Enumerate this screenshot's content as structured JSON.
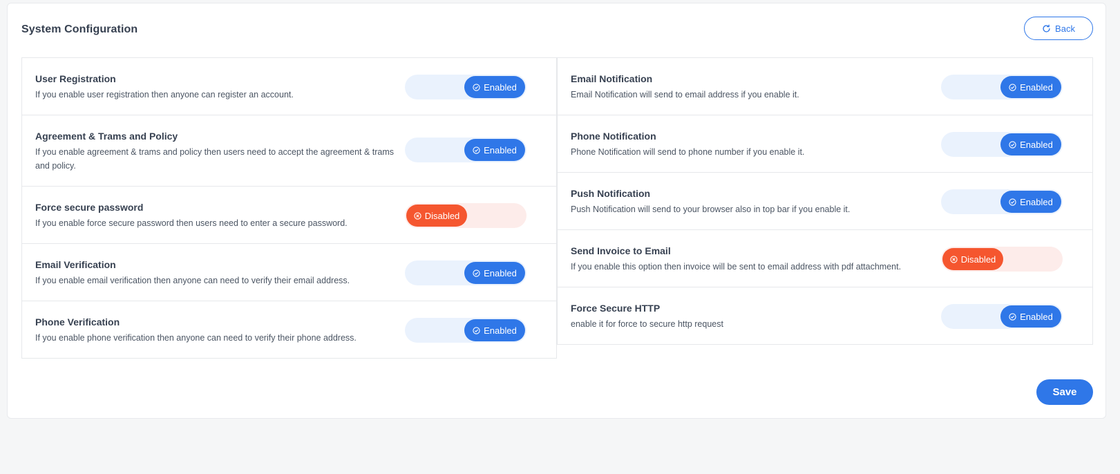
{
  "header": {
    "title": "System Configuration",
    "back_label": "Back"
  },
  "colors": {
    "accent": "#2f77e8",
    "enabled_track": "#eaf2fd",
    "disabled": "#f5562f",
    "disabled_track": "#fdecea"
  },
  "left_settings": [
    {
      "title": "User Registration",
      "description": "If you enable user registration then anyone can register an account.",
      "status": "Enabled",
      "enabled": true
    },
    {
      "title": "Agreement & Trams and Policy",
      "description": "If you enable agreement & trams and policy then users need to accept the agreement & trams and policy.",
      "status": "Enabled",
      "enabled": true
    },
    {
      "title": "Force secure password",
      "description": "If you enable force secure password then users need to enter a secure password.",
      "status": "Disabled",
      "enabled": false
    },
    {
      "title": "Email Verification",
      "description": "If you enable email verification then anyone can need to verify their email address.",
      "status": "Enabled",
      "enabled": true
    },
    {
      "title": "Phone Verification",
      "description": "If you enable phone verification then anyone can need to verify their phone address.",
      "status": "Enabled",
      "enabled": true
    }
  ],
  "right_settings": [
    {
      "title": "Email Notification",
      "description": "Email Notification will send to email address if you enable it.",
      "status": "Enabled",
      "enabled": true
    },
    {
      "title": "Phone Notification",
      "description": "Phone Notification will send to phone number if you enable it.",
      "status": "Enabled",
      "enabled": true
    },
    {
      "title": "Push Notification",
      "description": "Push Notification will send to your browser also in top bar if you enable it.",
      "status": "Enabled",
      "enabled": true
    },
    {
      "title": "Send Invoice to Email",
      "description": "If you enable this option then invoice will be sent to email address with pdf attachment.",
      "status": "Disabled",
      "enabled": false
    },
    {
      "title": "Force Secure HTTP",
      "description": "enable it for force to secure http request",
      "status": "Enabled",
      "enabled": true
    }
  ],
  "footer": {
    "save_label": "Save"
  }
}
